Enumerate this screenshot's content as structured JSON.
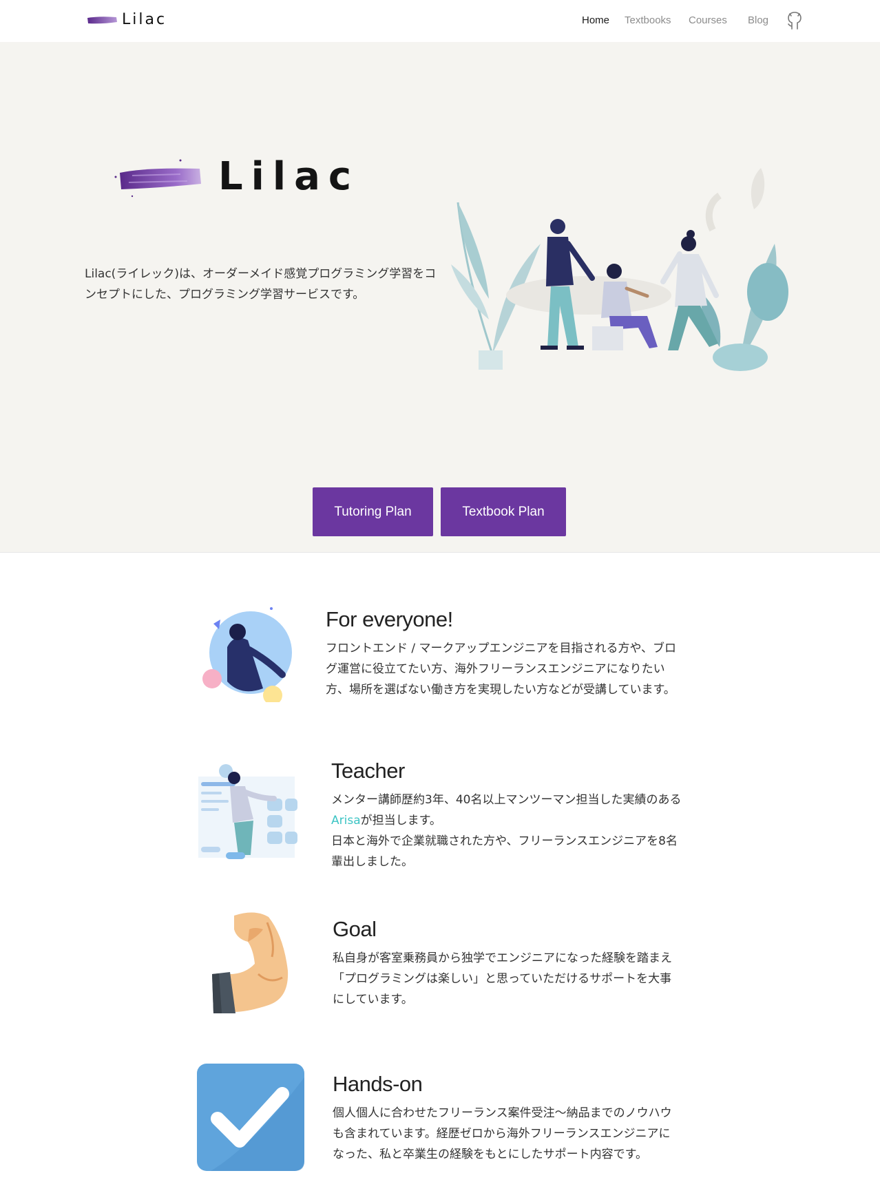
{
  "nav": {
    "brand": "Lilac",
    "links": [
      "Home",
      "Textbooks",
      "Courses",
      "Blog"
    ],
    "active": "Home",
    "github_icon": "github-icon"
  },
  "hero": {
    "brand": "Lilac",
    "description": "Lilac(ライレック)は、オーダーメイド感覚プログラミング学習をコンセプトにした、プログラミング学習サービスです。",
    "buttons": {
      "tutoring": "Tutoring Plan",
      "textbook": "Textbook Plan"
    },
    "accent_color": "#6b37a0"
  },
  "features": [
    {
      "title": "For everyone!",
      "lines": [
        "フロントエンド / マークアップエンジニアを目指される方や、ブロ",
        "グ運営に役立てたい方、海外フリーランスエンジニアになりたい",
        "方、場所を選ばない働き方を実現したい方などが受講しています。"
      ]
    },
    {
      "title": "Teacher",
      "line1": "メンター講師歴約3年、40名以上マンツーマン担当した実績のある",
      "link": "Arisa",
      "line2_rest": "が担当します。",
      "line3": "日本と海外で企業就職された方や、フリーランスエンジニアを8名",
      "line4": "輩出しました。"
    },
    {
      "title": "Goal",
      "lines": [
        "私自身が客室乗務員から独学でエンジニアになった経験を踏まえ",
        "「プログラミングは楽しい」と思っていただけるサポートを大事",
        "にしています。"
      ]
    },
    {
      "title": "Hands-on",
      "lines": [
        "個人個人に合わせたフリーランス案件受注〜納品までのノウハウ",
        "も含まれています。経歴ゼロから海外フリーランスエンジニアに",
        "なった、私と卒業生の経験をもとにしたサポート内容です。"
      ]
    }
  ]
}
